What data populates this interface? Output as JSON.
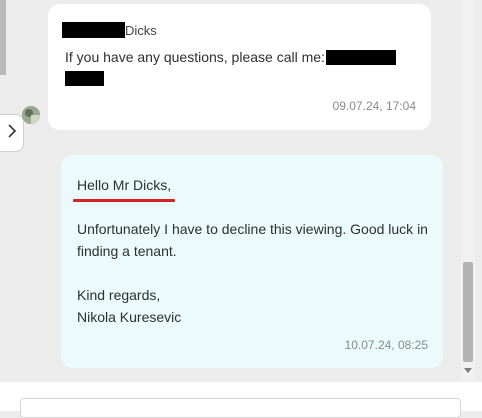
{
  "messages": {
    "incoming": {
      "sender_name": "Dicks",
      "text": "If you have any questions, please call me:",
      "timestamp": "09.07.24, 17:04"
    },
    "outgoing": {
      "greeting": "Hello Mr Dicks,",
      "body": "Unfortunately I have to decline this viewing. Good luck in finding a tenant.",
      "closing": "Kind regards,",
      "signature": "Nikola Kuresevic",
      "timestamp": "10.07.24, 08:25"
    }
  },
  "icons": {
    "collapse": "chevron-right-icon",
    "avatar": "avatar"
  },
  "colors": {
    "outgoing_bubble": "#ebfafa",
    "incoming_bubble": "#ffffff",
    "highlight_underline": "#d42027"
  }
}
